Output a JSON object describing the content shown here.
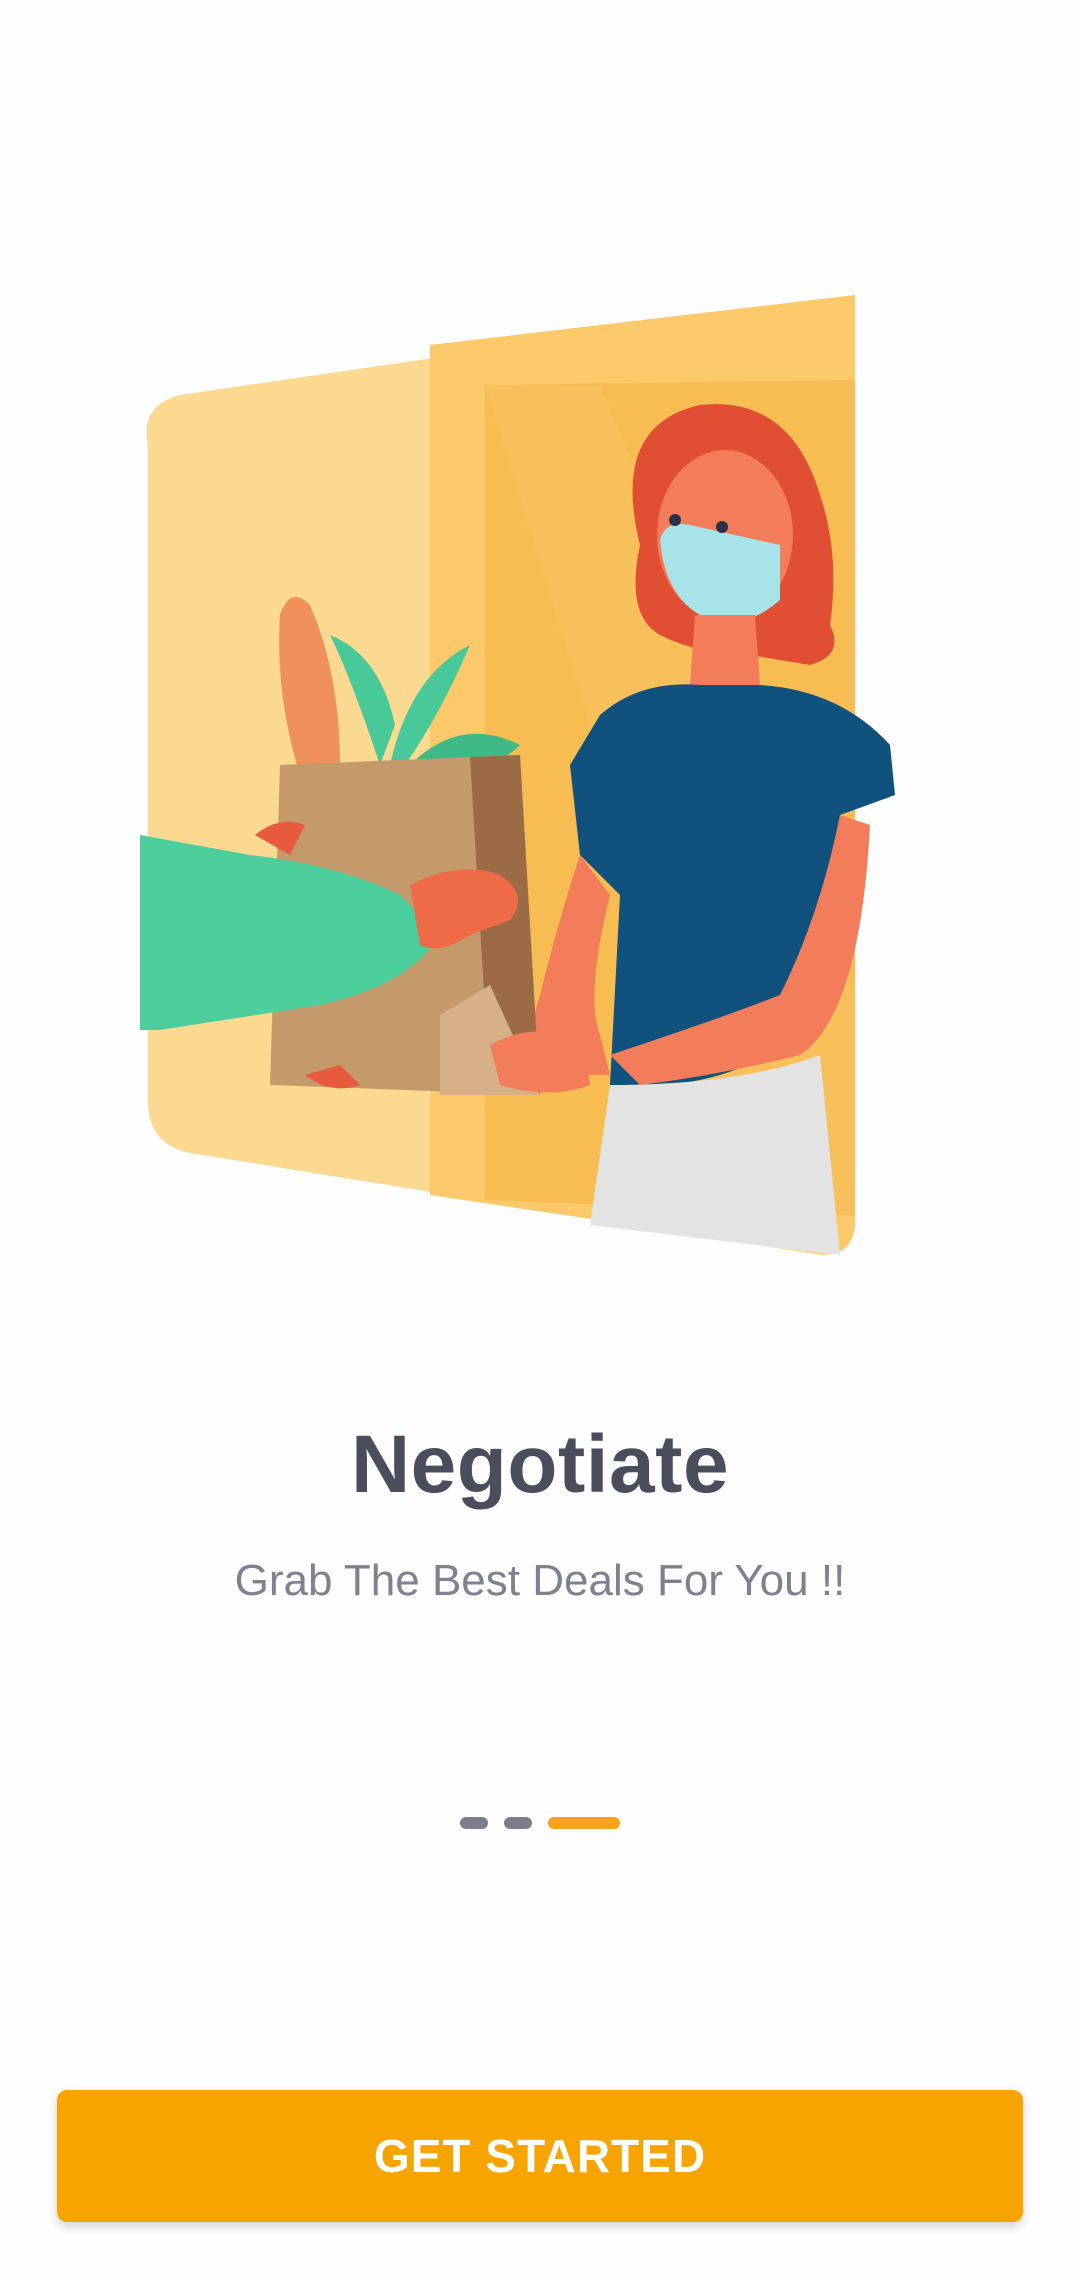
{
  "onboarding": {
    "illustration": "grocery-delivery-illustration",
    "title": "Negotiate",
    "subtitle": "Grab The Best Deals For You !!",
    "pager": {
      "total": 3,
      "active_index": 2
    },
    "cta_label": "GET STARTED"
  },
  "colors": {
    "accent": "#f7a400",
    "title": "#4a4d5c",
    "subtitle": "#7e8190",
    "dot_inactive": "#7c7d8c"
  }
}
